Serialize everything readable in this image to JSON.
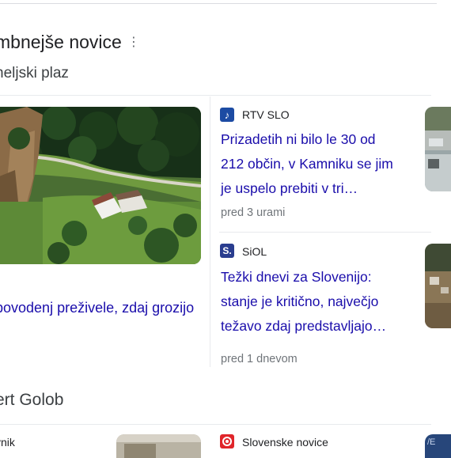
{
  "section": {
    "title": "mbnejše novice",
    "subtitle": "neljski plaz"
  },
  "featured": {
    "headline": "povodenj preživele, zdaj grozijo",
    "image_icon": "landslide-aerial-photo"
  },
  "stories": [
    {
      "source": "RTV SLO",
      "source_icon": "rtv-slo-logo-icon",
      "source_icon_glyph": "♪",
      "source_color": "#1c4ba3",
      "headline_lines": [
        "Prizadetih ni bilo le 30 od",
        "212 občin, v Kamniku se jim",
        "je uspelo prebiti v tri…"
      ],
      "time": "pred 3 urami"
    },
    {
      "source": "SiOL",
      "source_icon": "siol-logo-icon",
      "source_icon_glyph": "S.",
      "source_color": "#2a3d8f",
      "headline_lines": [
        "Težki dnevi za Slovenijo:",
        "stanje je kritično, največjo",
        "težavo zdaj predstavljajo…"
      ],
      "time": "pred 1 dnevom"
    }
  ],
  "section2": {
    "title": "ert Golob"
  },
  "bottom_items": [
    {
      "source": "vnik"
    },
    {
      "source": "Slovenske novice",
      "source_icon": "slovenske-novice-logo-icon",
      "source_color": "#e0252a",
      "thumb_text": "/E"
    }
  ]
}
